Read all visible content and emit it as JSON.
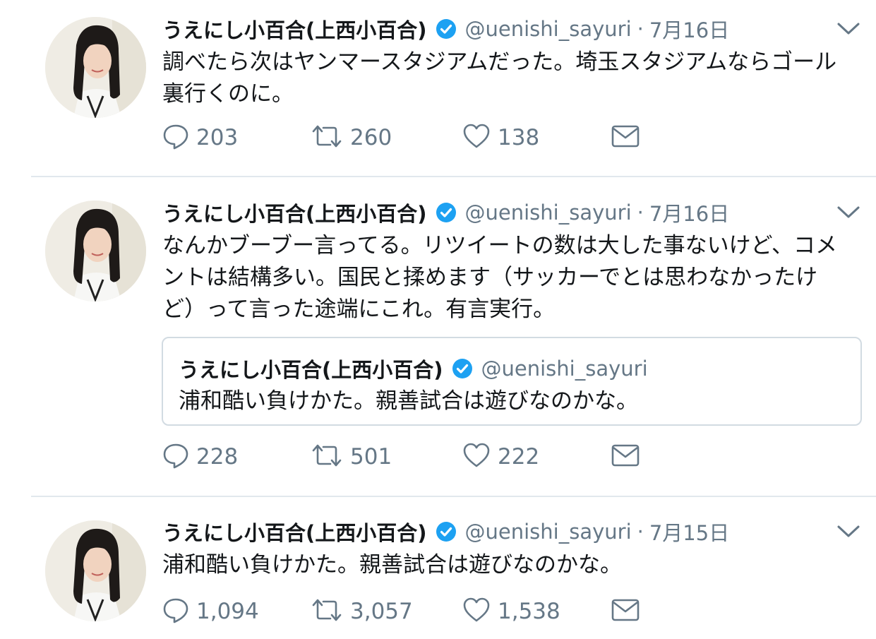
{
  "colors": {
    "text": "#14171a",
    "secondary": "#657786",
    "verified": "#1da1f2",
    "divider": "#e1e8ed"
  },
  "tweets": [
    {
      "name": "うえにし小百合(上西小百合)",
      "handle": "@uenishi_sayuri",
      "separator": "·",
      "date": "7月16日",
      "lines": [
        "調べたら次はヤンマースタジアムだった。埼玉スタジアムならゴール",
        "裏行くのに。"
      ],
      "replies": "203",
      "retweets": "260",
      "likes": "138"
    },
    {
      "name": "うえにし小百合(上西小百合)",
      "handle": "@uenishi_sayuri",
      "separator": "·",
      "date": "7月16日",
      "lines": [
        "なんかブーブー言ってる。リツイートの数は大した事ないけど、コメ",
        "ントは結構多い。国民と揉めます（サッカーでとは思わなかったけ",
        "ど）って言った途端にこれ。有言実行。"
      ],
      "quote": {
        "name": "うえにし小百合(上西小百合)",
        "handle": "@uenishi_sayuri",
        "text": "浦和酷い負けかた。親善試合は遊びなのかな。"
      },
      "replies": "228",
      "retweets": "501",
      "likes": "222"
    },
    {
      "name": "うえにし小百合(上西小百合)",
      "handle": "@uenishi_sayuri",
      "separator": "·",
      "date": "7月15日",
      "lines": [
        "浦和酷い負けかた。親善試合は遊びなのかな。"
      ],
      "replies": "1,094",
      "retweets": "3,057",
      "likes": "1,538"
    }
  ],
  "icons": {
    "reply": "reply-icon",
    "retweet": "retweet-icon",
    "like": "like-icon",
    "dm": "direct-message-icon",
    "verified": "verified-badge-icon",
    "menu": "chevron-down-icon"
  }
}
